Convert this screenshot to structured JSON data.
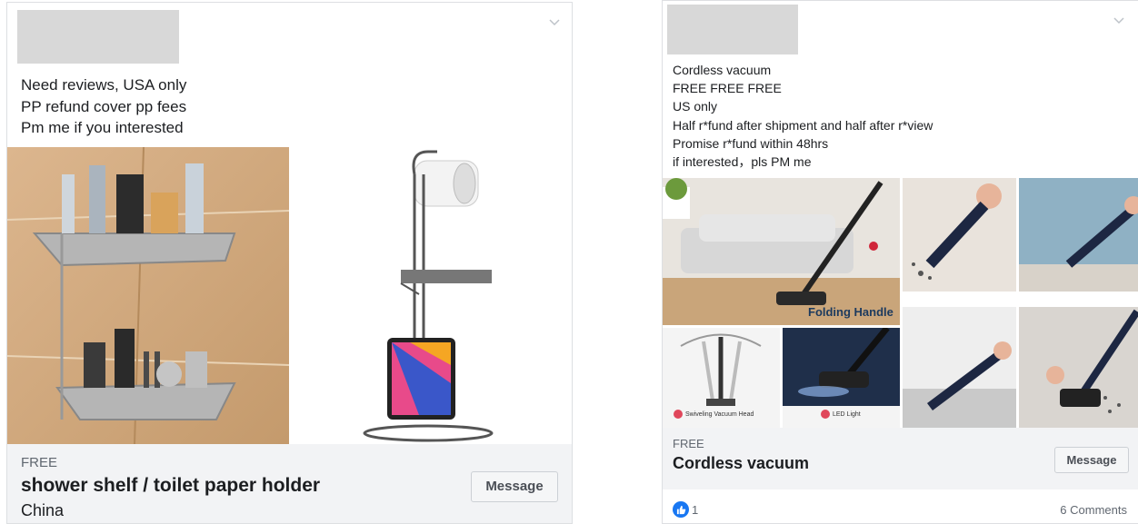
{
  "listing1": {
    "post_lines": "Need reviews, USA only\nPP refund cover pp fees\nPm me if you interested",
    "price": "FREE",
    "title": "shower shelf / toilet paper holder",
    "location": "China",
    "message_label": "Message",
    "icons": {
      "menu": "chevron-down-icon"
    },
    "images": [
      "corner shower caddy",
      "toilet paper holder stand"
    ]
  },
  "listing2": {
    "post_lines": "Cordless vacuum\nFREE FREE FREE\nUS only\nHalf r*fund after shipment and half after r*view\nPromise r*fund within 48hrs\nif interested，pls PM me",
    "price": "FREE",
    "title": "Cordless vacuum",
    "message_label": "Message",
    "folding_caption": "Folding Handle",
    "swivel_caption": "Swiveling Vacuum Head",
    "led_caption": "LED Light",
    "like_count": "1",
    "comments": "6 Comments",
    "icons": {
      "menu": "chevron-down-icon",
      "like": "thumbs-up-icon"
    }
  },
  "colors": {
    "like_blue": "#1877f2",
    "footer_bg": "#f2f3f5",
    "border": "#dddfe2"
  }
}
